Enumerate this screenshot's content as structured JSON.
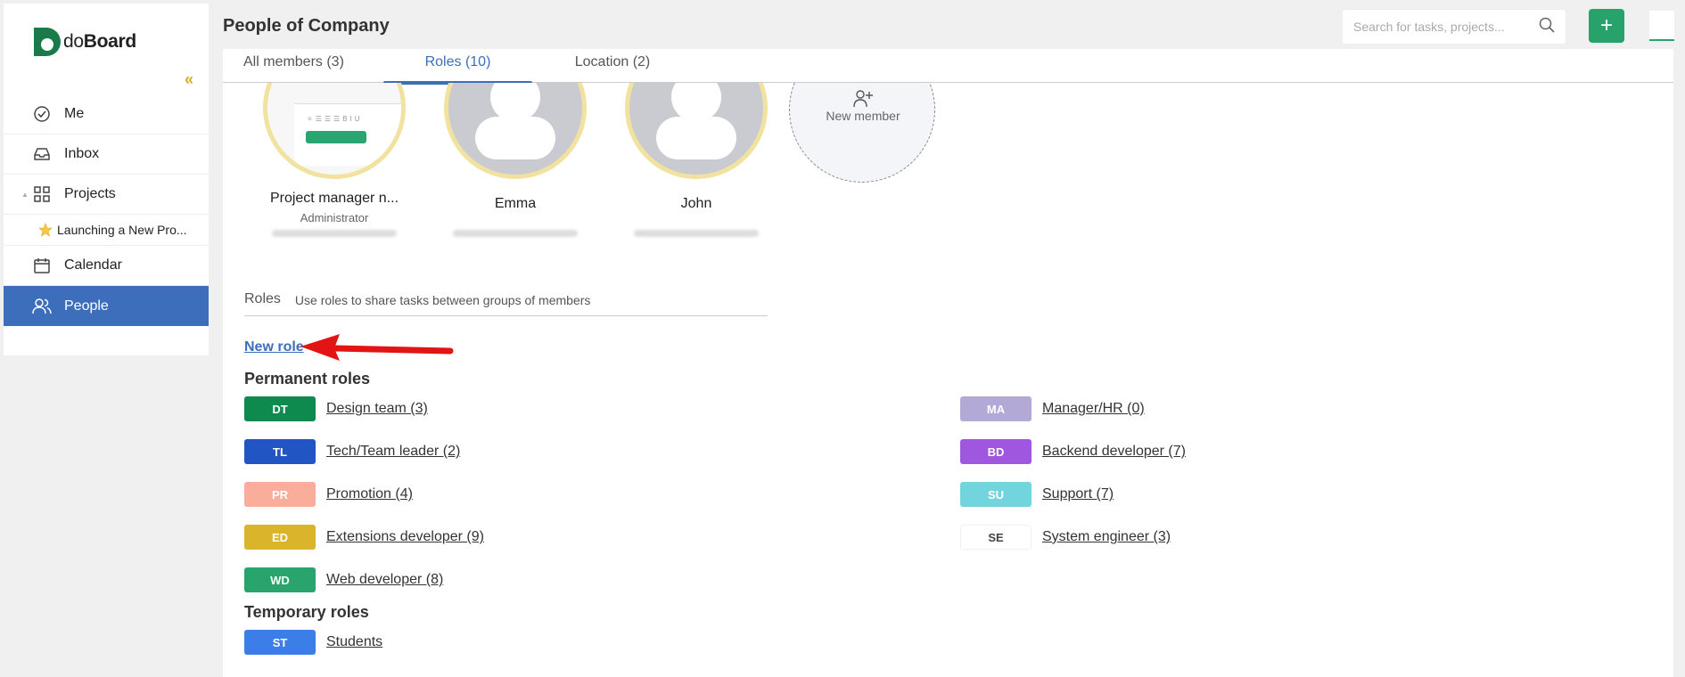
{
  "app": {
    "logo_prefix": "do",
    "logo_bold": "Board",
    "brand_color": "#27a26b",
    "accent": "#3d6ebc"
  },
  "sidebar": {
    "items": [
      {
        "label": "Me",
        "icon": "check-circle-icon"
      },
      {
        "label": "Inbox",
        "icon": "inbox-icon"
      },
      {
        "label": "Projects",
        "icon": "grid-icon"
      },
      {
        "label": "Launching a New Pro...",
        "icon": "star-icon"
      },
      {
        "label": "Calendar",
        "icon": "calendar-icon"
      },
      {
        "label": "People",
        "icon": "people-icon",
        "active": true
      }
    ]
  },
  "header": {
    "title": "People of Company",
    "search_placeholder": "Search for tasks, projects..."
  },
  "tabs": [
    {
      "label": "All members (3)"
    },
    {
      "label": "Roles (10)",
      "active": true
    },
    {
      "label": "Location (2)"
    }
  ],
  "members": [
    {
      "name": "Project manager n...",
      "role": "Administrator"
    },
    {
      "name": "Emma",
      "role": ""
    },
    {
      "name": "John",
      "role": ""
    }
  ],
  "new_member_label": "New member",
  "roles": {
    "title": "Roles",
    "description": "Use roles to share tasks between groups of members",
    "new_role_label": "New role",
    "permanent_title": "Permanent roles",
    "temporary_title": "Temporary roles",
    "permanent": [
      {
        "abbr": "DT",
        "label": "Design team (3)",
        "color": "#0f8a4e"
      },
      {
        "abbr": "TL",
        "label": "Tech/Team leader (2)",
        "color": "#2155c4"
      },
      {
        "abbr": "PR",
        "label": "Promotion (4)",
        "color": "#f9ad9a"
      },
      {
        "abbr": "ED",
        "label": "Extensions developer (9)",
        "color": "#dab42a"
      },
      {
        "abbr": "WD",
        "label": "Web developer (8)",
        "color": "#29a46c"
      },
      {
        "abbr": "MA",
        "label": "Manager/HR (0)",
        "color": "#b3a9d6"
      },
      {
        "abbr": "BD",
        "label": "Backend developer (7)",
        "color": "#9f57e0"
      },
      {
        "abbr": "SU",
        "label": "Support (7)",
        "color": "#72d4dc"
      },
      {
        "abbr": "SE",
        "label": "System engineer (3)",
        "color": "#ffffff"
      }
    ],
    "temporary": [
      {
        "abbr": "ST",
        "label": "Students",
        "color": "#3b7ee8"
      }
    ]
  }
}
